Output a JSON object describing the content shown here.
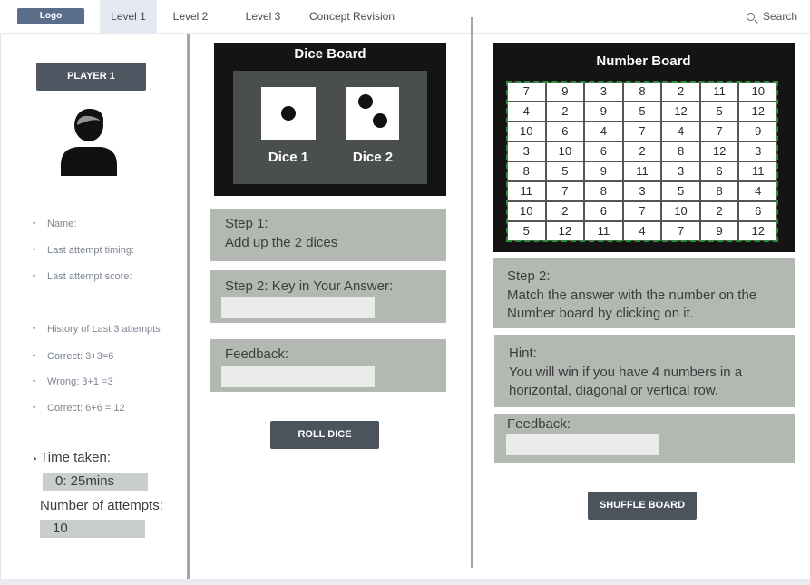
{
  "nav": {
    "logo": "Logo",
    "tabs": [
      "Level 1",
      "Level 2",
      "Level 3",
      "Concept Revision"
    ],
    "search_label": "Search"
  },
  "player": {
    "button_label": "PLAYER 1",
    "info": [
      "Name:",
      "Last attempt timing:",
      "Last attempt score:"
    ],
    "history": [
      "History of Last 3 attempts",
      "Correct: 3+3=6",
      "Wrong: 3+1 =3",
      "Correct: 6+6 = 12"
    ],
    "time_label": "Time taken:",
    "time_value": "0: 25mins",
    "attempts_label": "Number of attempts:",
    "attempts_value": "10"
  },
  "dice_board": {
    "title": "Dice Board",
    "dice1_label": "Dice 1",
    "dice2_label": "Dice 2",
    "dice1_value": 1,
    "dice2_value": 2
  },
  "middle": {
    "step1_title": "Step 1:",
    "step1_text": "Add up the 2 dices",
    "step2_label": "Step 2: Key in Your Answer:",
    "feedback_label": "Feedback:",
    "roll_button": "ROLL DICE"
  },
  "number_board": {
    "title": "Number Board",
    "rows": [
      [
        "7",
        "9",
        "3",
        "8",
        "2",
        "11",
        "10"
      ],
      [
        "4",
        "2",
        "9",
        "5",
        "12",
        "5",
        "12"
      ],
      [
        "10",
        "6",
        "4",
        "7",
        "4",
        "7",
        "9"
      ],
      [
        "3",
        "10",
        "6",
        "2",
        "8",
        "12",
        "3"
      ],
      [
        "8",
        "5",
        "9",
        "11",
        "3",
        "6",
        "11"
      ],
      [
        "11",
        "7",
        "8",
        "3",
        "5",
        "8",
        "4"
      ],
      [
        "10",
        "2",
        "6",
        "7",
        "10",
        "2",
        "6"
      ],
      [
        "5",
        "12",
        "11",
        "4",
        "7",
        "9",
        "12"
      ]
    ]
  },
  "right": {
    "step2_title": "Step 2:",
    "step2_line1": "Match the answer with the number on the",
    "step2_line2": "Number board by clicking on it.",
    "hint_title": "Hint:",
    "hint_line1": "You will win if you have 4 numbers in a",
    "hint_line2": "horizontal, diagonal or vertical row.",
    "feedback_label": "Feedback:",
    "shuffle_button": "SHUFFLE BOARD"
  }
}
